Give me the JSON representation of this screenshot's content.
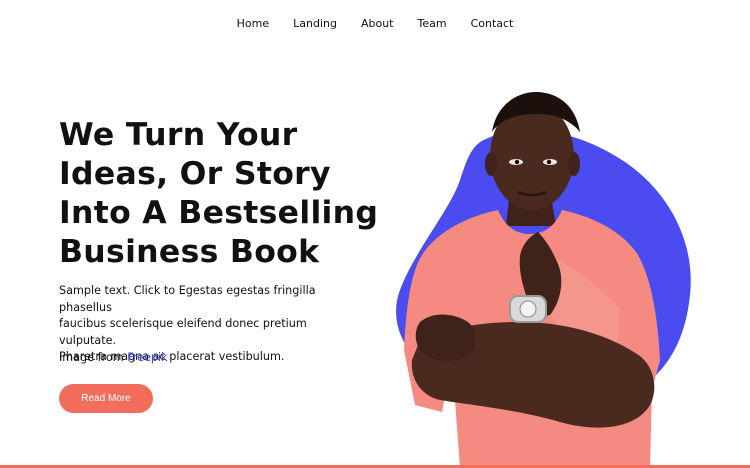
{
  "nav": {
    "items": [
      {
        "label": "Home"
      },
      {
        "label": "Landing"
      },
      {
        "label": "About"
      },
      {
        "label": "Team"
      },
      {
        "label": "Contact"
      }
    ]
  },
  "hero": {
    "title_lines": [
      "We Turn Your",
      "Ideas, Or Story",
      "Into A Bestselling",
      "Business Book"
    ],
    "text_lines": [
      "Sample text. Click to Egestas egestas fringilla phasellus",
      "faucibus scelerisque eleifend donec pretium vulputate.",
      "Pharetra magna ac placerat vestibulum."
    ],
    "credit_prefix": "Image from ",
    "credit_link": "Freepik",
    "cta_label": "Read More"
  },
  "colors": {
    "accent": "#f26d5b",
    "blob": "#4a4cf0",
    "shirt": "#f58b80",
    "skin": "#4a2a1f",
    "link": "#3a3fd6"
  }
}
